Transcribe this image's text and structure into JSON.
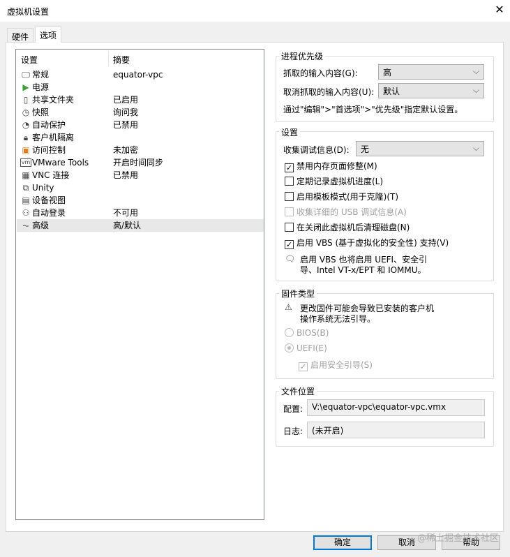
{
  "window": {
    "title": "虚拟机设置",
    "close_icon": "close-icon"
  },
  "tabs": [
    {
      "label": "硬件"
    },
    {
      "label": "选项"
    }
  ],
  "list": {
    "headers": [
      "设置",
      "摘要"
    ],
    "items": [
      {
        "name": "常规",
        "summary": "equator-vpc",
        "icon": "monitor-icon"
      },
      {
        "name": "电源",
        "summary": "",
        "icon": "play-icon"
      },
      {
        "name": "共享文件夹",
        "summary": "已启用",
        "icon": "shared-folder-icon"
      },
      {
        "name": "快照",
        "summary": "询问我",
        "icon": "snapshot-icon"
      },
      {
        "name": "自动保护",
        "summary": "已禁用",
        "icon": "clock-icon"
      },
      {
        "name": "客户机隔离",
        "summary": "",
        "icon": "lock-icon"
      },
      {
        "name": "访问控制",
        "summary": "未加密",
        "icon": "access-lock-icon"
      },
      {
        "name": "VMware Tools",
        "summary": "开启时间同步",
        "icon": "vm-icon"
      },
      {
        "name": "VNC 连接",
        "summary": "已禁用",
        "icon": "vnc-icon"
      },
      {
        "name": "Unity",
        "summary": "",
        "icon": "unity-icon"
      },
      {
        "name": "设备视图",
        "summary": "",
        "icon": "device-view-icon"
      },
      {
        "name": "自动登录",
        "summary": "不可用",
        "icon": "user-key-icon"
      },
      {
        "name": "高级",
        "summary": "高/默认",
        "icon": "pulse-icon"
      }
    ],
    "selected": "高级"
  },
  "priority": {
    "title": "进程优先级",
    "grab_label": "抓取的输入内容(G):",
    "grab_value": "高",
    "ungrab_label": "取消抓取的输入内容(U):",
    "ungrab_value": "默认",
    "note": "通过\"编辑\">\"首选项\">\"优先级\"指定默认设置。"
  },
  "settings": {
    "title": "设置",
    "debug_label": "收集调试信息(D):",
    "debug_value": "无",
    "checks": [
      {
        "label": "禁用内存页面修整(M)",
        "checked": true,
        "disabled": false
      },
      {
        "label": "定期记录虚拟机进度(L)",
        "checked": false,
        "disabled": false
      },
      {
        "label": "启用模板模式(用于克隆)(T)",
        "checked": false,
        "disabled": false
      },
      {
        "label": "收集详细的 USB 调试信息(A)",
        "checked": false,
        "disabled": true
      },
      {
        "label": "在关闭此虚拟机后清理磁盘(N)",
        "checked": false,
        "disabled": false
      },
      {
        "label": "启用 VBS (基于虚拟化的安全性) 支持(V)",
        "checked": true,
        "disabled": false
      }
    ],
    "info_line1": "启用 VBS 也将启用 UEFI、安全引",
    "info_line2": "导、Intel VT-x/EPT 和 IOMMU。"
  },
  "firmware": {
    "title": "固件类型",
    "warn_line1": "更改固件可能会导致已安装的客户机",
    "warn_line2": "操作系统无法引导。",
    "bios": "BIOS(B)",
    "uefi": "UEFI(E)",
    "secure_boot": "启用安全引导(S)",
    "selected": "UEFI"
  },
  "files": {
    "title": "文件位置",
    "config_label": "配置:",
    "config_value": "V:\\equator-vpc\\equator-vpc.vmx",
    "log_label": "日志:",
    "log_value": "(未开启)"
  },
  "buttons": {
    "ok": "确定",
    "cancel": "取消",
    "help": "帮助"
  },
  "watermark": "@稀土掘金技术社区"
}
